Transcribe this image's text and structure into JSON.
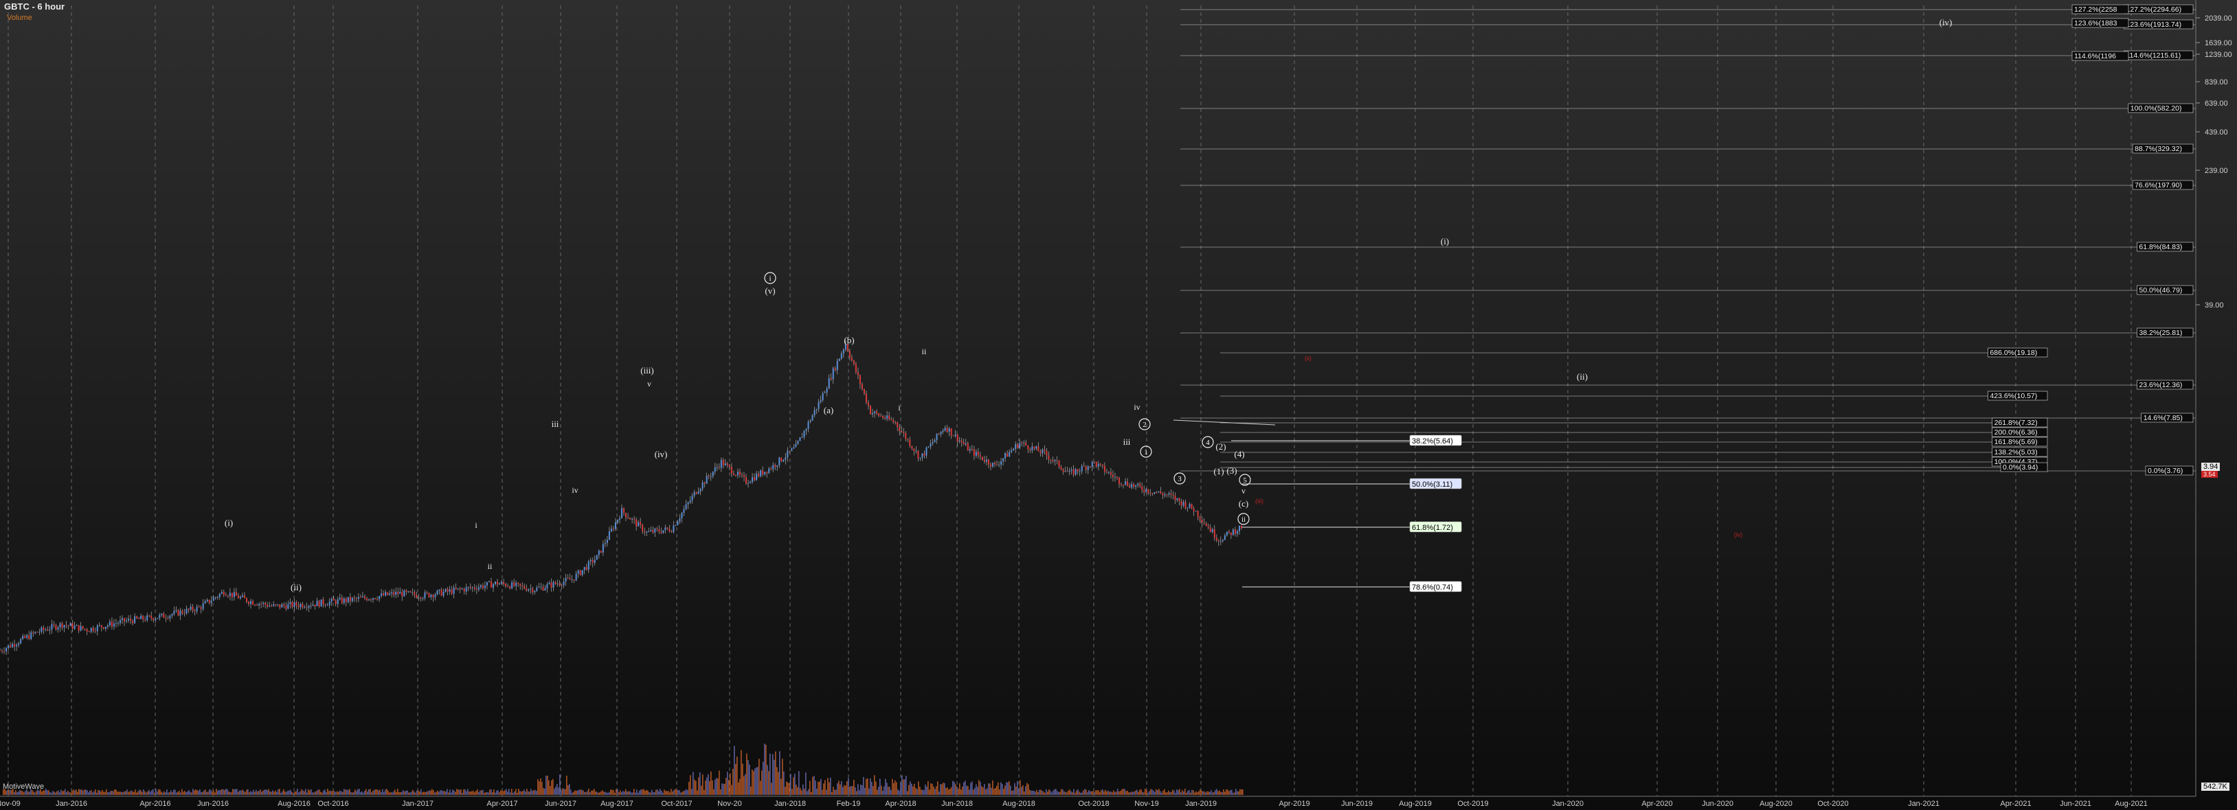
{
  "header": {
    "title": "GBTC - 6 hour",
    "volume_label": "Volume",
    "indicator_label": "MotiveWave",
    "current_price": "3.94",
    "current_price_sub": "3.54",
    "volume_value": "542.7K"
  },
  "colors": {
    "background_top": "#2e2e2e",
    "background_bottom": "#0c0c0c",
    "up_candle": "#5a8fd6",
    "down_candle": "#d83a3a",
    "wick": "#d8d8d8",
    "volume": "#c8622a",
    "fib_line": "#cfcfcf",
    "grid": "#6a6a6a",
    "label_red": "#b82020"
  },
  "chart_data": {
    "type": "candlestick",
    "x_axis_labels": [
      "Nov-09",
      "Jan-2016",
      "Apr-2016",
      "Jun-2016",
      "Aug-2016",
      "Oct-2016",
      "Jan-2017",
      "Apr-2017",
      "Jun-2017",
      "Aug-2017",
      "Oct-2017",
      "Nov-20",
      "Jan-2018",
      "Feb-19",
      "Apr-2018",
      "Jun-2018",
      "Aug-2018",
      "Oct-2018",
      "Nov-19",
      "Jan-2019",
      "Apr-2019",
      "Jun-2019",
      "Aug-2019",
      "Oct-2019",
      "Jan-2020",
      "Apr-2020",
      "Jun-2020",
      "Aug-2020",
      "Oct-2020",
      "Jan-2021",
      "Apr-2021",
      "Jun-2021",
      "Aug-2021"
    ],
    "y_axis_labels": [
      "2039.00",
      "1639.00",
      "1239.00",
      "839.00",
      "639.00",
      "439.00",
      "239.00",
      "39.00"
    ],
    "price_path": [
      {
        "t": 0.0,
        "p": 7.2
      },
      {
        "t": 0.03,
        "p": 9.6
      },
      {
        "t": 0.05,
        "p": 10.6
      },
      {
        "t": 0.07,
        "p": 9.9
      },
      {
        "t": 0.1,
        "p": 11.0
      },
      {
        "t": 0.13,
        "p": 11.6
      },
      {
        "t": 0.16,
        "p": 12.7
      },
      {
        "t": 0.18,
        "p": 14.8
      },
      {
        "t": 0.2,
        "p": 13.6
      },
      {
        "t": 0.22,
        "p": 12.9
      },
      {
        "t": 0.25,
        "p": 13.2
      },
      {
        "t": 0.28,
        "p": 13.7
      },
      {
        "t": 0.3,
        "p": 14.1
      },
      {
        "t": 0.32,
        "p": 14.6
      },
      {
        "t": 0.34,
        "p": 14.3
      },
      {
        "t": 0.36,
        "p": 14.8
      },
      {
        "t": 0.38,
        "p": 15.3
      },
      {
        "t": 0.4,
        "p": 15.9
      },
      {
        "t": 0.43,
        "p": 15.1
      },
      {
        "t": 0.46,
        "p": 16.4
      },
      {
        "t": 0.48,
        "p": 19.2
      },
      {
        "t": 0.5,
        "p": 25.2
      },
      {
        "t": 0.52,
        "p": 22.4
      },
      {
        "t": 0.54,
        "p": 22.9
      },
      {
        "t": 0.56,
        "p": 27.8
      },
      {
        "t": 0.58,
        "p": 31.5
      },
      {
        "t": 0.6,
        "p": 29.0
      },
      {
        "t": 0.62,
        "p": 30.8
      },
      {
        "t": 0.64,
        "p": 33.4
      },
      {
        "t": 0.66,
        "p": 39.6
      },
      {
        "t": 0.68,
        "p": 46.8
      },
      {
        "t": 0.7,
        "p": 38.0
      },
      {
        "t": 0.72,
        "p": 36.6
      },
      {
        "t": 0.74,
        "p": 32.0
      },
      {
        "t": 0.76,
        "p": 36.1
      },
      {
        "t": 0.78,
        "p": 33.0
      },
      {
        "t": 0.8,
        "p": 31.0
      },
      {
        "t": 0.82,
        "p": 34.0
      },
      {
        "t": 0.84,
        "p": 32.6
      },
      {
        "t": 0.86,
        "p": 30.0
      },
      {
        "t": 0.88,
        "p": 31.4
      },
      {
        "t": 0.9,
        "p": 29.1
      },
      {
        "t": 0.92,
        "p": 28.0
      },
      {
        "t": 0.94,
        "p": 27.2
      },
      {
        "t": 0.96,
        "p": 25.4
      },
      {
        "t": 0.98,
        "p": 21.5
      },
      {
        "t": 1.0,
        "p": 23.3
      }
    ],
    "fib_levels_right": [
      "127.2%(2294.66)",
      "123.6%(1913.74)",
      "114.6%(1215.61)",
      "100.0%(582.20)",
      "88.7%(329.32)",
      "76.6%(197.90)",
      "61.8%(84.83)",
      "50.0%(46.79)",
      "38.2%(25.81)",
      "23.6%(12.36)",
      "14.6%(7.85)",
      "0.0%(3.76)"
    ],
    "fib_levels_left": [
      "127.2%(2258",
      "123.6%(1883",
      "114.6%(1196"
    ],
    "fib_levels_mid": [
      "686.0%(19.18)",
      "423.6%(10.57)",
      "261.8%(7.32)",
      "200.0%(6.36)",
      "161.8%(5.69)",
      "138.2%(5.03)",
      "100.0%(4.37)",
      "0.0%(3.94)"
    ],
    "fib_levels_low": [
      "38.2%(5.64)",
      "50.0%(3.11)",
      "61.8%(1.72)",
      "78.6%(0.74)"
    ],
    "wave_labels_circled": [
      "1",
      "2",
      "3",
      "4",
      "5",
      "i",
      "ii"
    ],
    "wave_labels_text": [
      "(i)",
      "(ii)",
      "(iii)",
      "(iv)",
      "(v)",
      "(a)",
      "(b)",
      "(c)",
      "(1)",
      "(2)",
      "(3)",
      "(4)",
      "i",
      "ii",
      "iii",
      "iv",
      "v",
      "(i)",
      "(ii)",
      "(iv)"
    ]
  }
}
